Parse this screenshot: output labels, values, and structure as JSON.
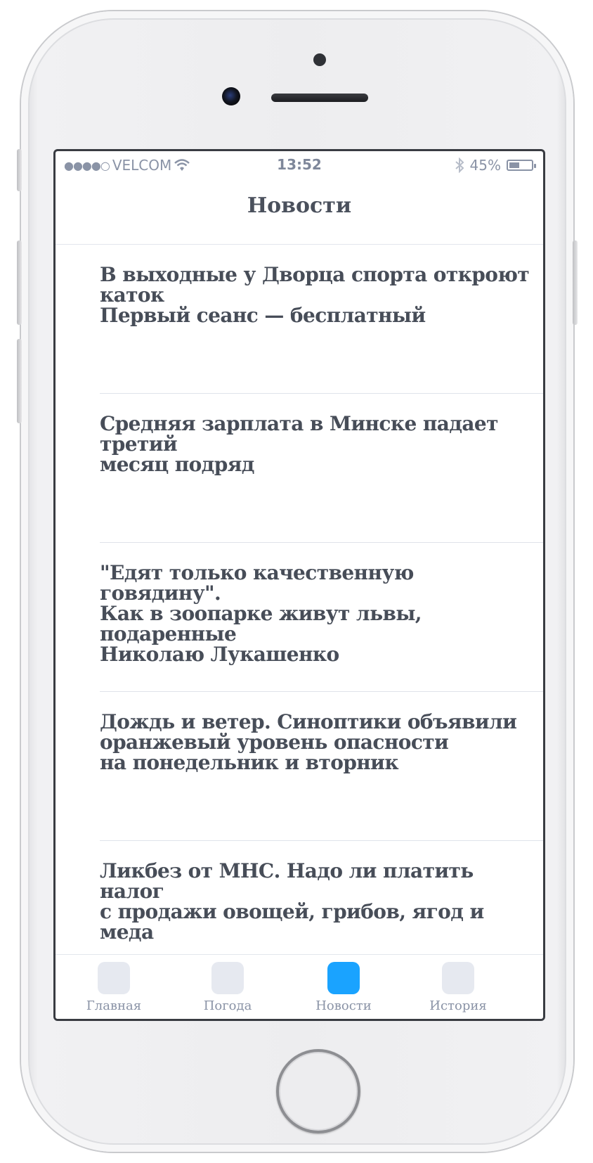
{
  "status_bar": {
    "signal": "●●●●○",
    "carrier": "VELCOM",
    "time": "13:52",
    "battery_percent": "45%",
    "battery_level": 0.45
  },
  "nav": {
    "title": "Новости"
  },
  "news": [
    {
      "title": "В выходные у Дворца спорта откроют каток\nПервый сеанс — бесплатный"
    },
    {
      "title": "Средняя зарплата в Минске падает третий\nмесяц подряд"
    },
    {
      "title": "\"Едят только качественную говядину\".\nКак в зоопарке живут львы, подаренные\nНиколаю Лукашенко"
    },
    {
      "title": "Дождь и ветер. Синоптики объявили\nоранжевый уровень опасности\nна понедельник и вторник"
    },
    {
      "title": "Ликбез от МНС. Надо ли платить налог\nс продажи овощей, грибов, ягод и меда"
    }
  ],
  "tabs": [
    {
      "label": "Главная"
    },
    {
      "label": "Погода"
    },
    {
      "label": "Новости"
    },
    {
      "label": "История"
    }
  ],
  "colors": {
    "accent": "#1aa3ff",
    "text": "#474d58",
    "muted": "#8a93a6"
  }
}
